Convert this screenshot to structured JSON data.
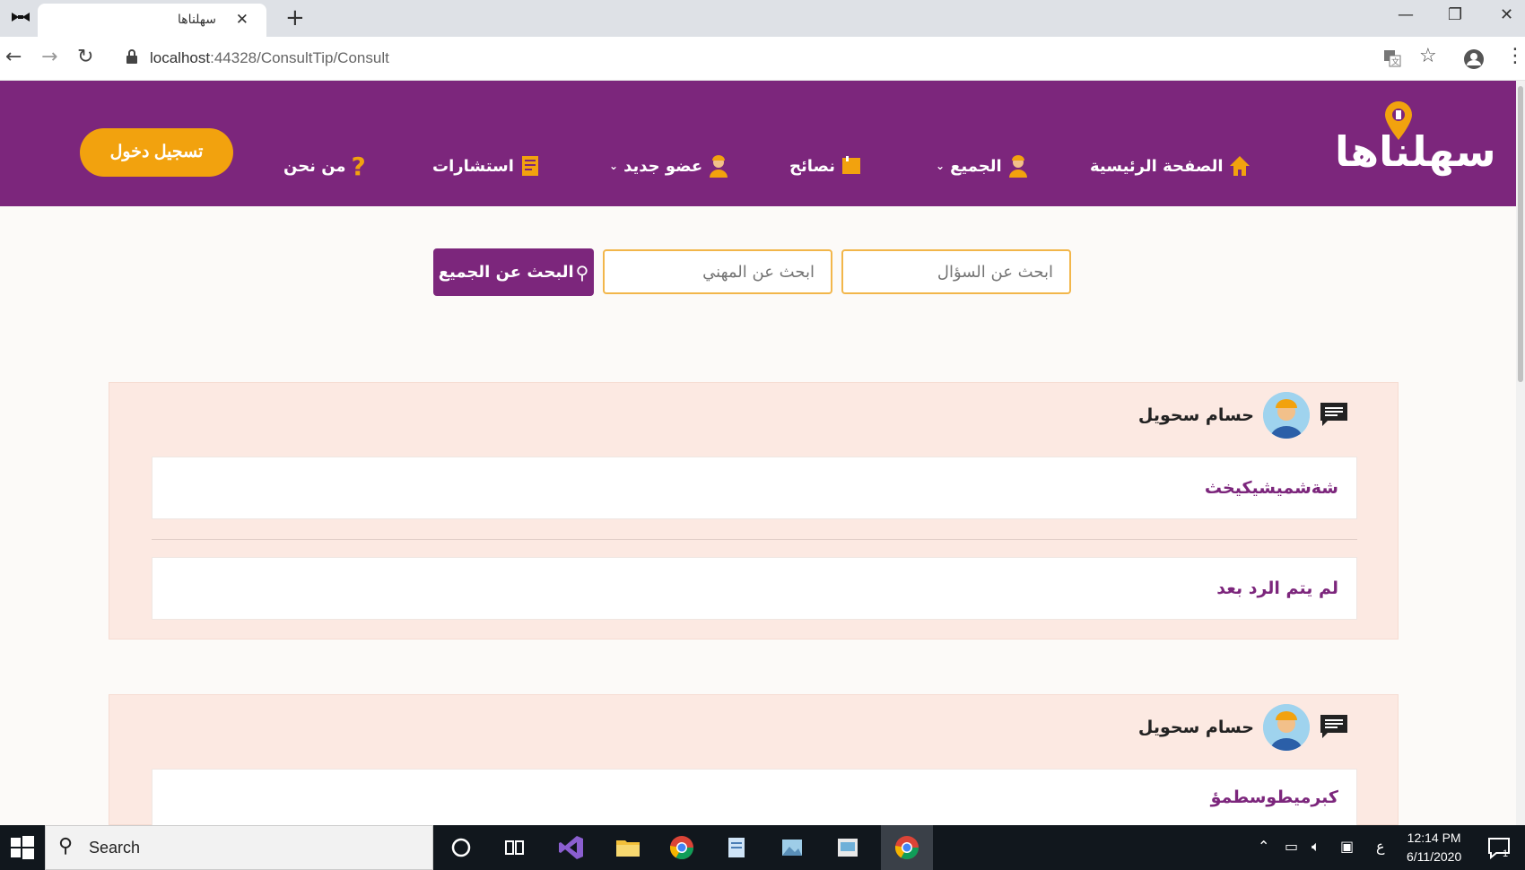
{
  "browser": {
    "tab_title": "سهلناها",
    "tab_close": "✕",
    "new_tab": "+",
    "url_host": "localhost",
    "url_path": ":44328/ConsultTip/Consult"
  },
  "header": {
    "logo": "سهلناها",
    "nav": {
      "home": "الصفحة الرئيسية",
      "all": "الجميع",
      "tips": "نصائح",
      "new_member": "عضو جديد",
      "consultations": "استشارات",
      "about": "من نحن"
    },
    "login": "تسجيل دخول"
  },
  "search": {
    "question_placeholder": "ابحث عن السؤال",
    "professional_placeholder": "ابحث عن المهني",
    "button": "البحث عن الجميع"
  },
  "consultations": [
    {
      "user": "حسام سحويل",
      "question": "شةشميشيكيخث",
      "answer": "لم يتم الرد بعد"
    },
    {
      "user": "حسام سحويل",
      "question": "كبرميطوسطمؤ"
    }
  ],
  "taskbar": {
    "search": "Search",
    "time": "12:14 PM",
    "date": "6/11/2020",
    "lang": "ع",
    "notifications": "1"
  },
  "colors": {
    "brand": "#7c267c",
    "accent": "#f2a20e",
    "card_bg": "#fce9e2"
  }
}
